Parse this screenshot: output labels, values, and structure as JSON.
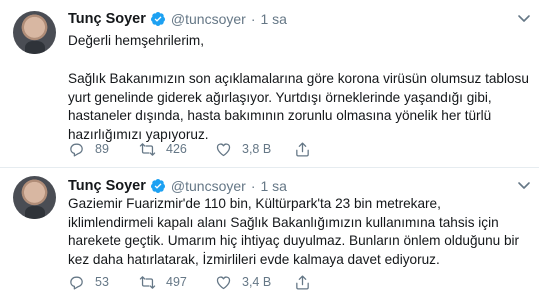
{
  "tweets": [
    {
      "author": "Tunç Soyer",
      "handle": "@tuncsoyer",
      "separator": "·",
      "time": "1 sa",
      "greeting": "Değerli hemşehrilerim,",
      "lines": [
        "Sağlık Bakanımızın son açıklamalarına göre korona virüsün olumsuz tablosu",
        "yurt genelinde giderek ağırlaşıyor. Yurtdışı örneklerinde yaşandığı gibi,",
        "hastaneler dışında, hasta bakımının zorunlu olmasına yönelik her türlü",
        "hazırlığımızı yapıyoruz."
      ],
      "replies": "89",
      "retweets": "426",
      "likes": "3,8 B"
    },
    {
      "author": "Tunç Soyer",
      "handle": "@tuncsoyer",
      "separator": "·",
      "time": "1 sa",
      "lines": [
        "Gaziemir Fuarizmir'de 110 bin, Kültürpark'ta 23 bin metrekare,",
        "iklimlendirmeli kapalı alanı Sağlık Bakanlığımızın kullanımına tahsis için",
        "harekete geçtik. Umarım hiç ihtiyaç duyulmaz. Bunların önlem olduğunu bir",
        "kez daha hatırlatarak, İzmirlileri evde kalmaya davet ediyoruz."
      ],
      "replies": "53",
      "retweets": "497",
      "likes": "3,4 B"
    }
  ],
  "icons": {
    "verified": "verified-badge-icon",
    "menu": "chevron-down-icon",
    "reply": "reply-icon",
    "retweet": "retweet-icon",
    "like": "heart-icon",
    "share": "share-icon"
  },
  "colors": {
    "accent": "#1da1f2",
    "muted": "#657786",
    "text": "#14171a",
    "divider": "#e6ecf0"
  }
}
